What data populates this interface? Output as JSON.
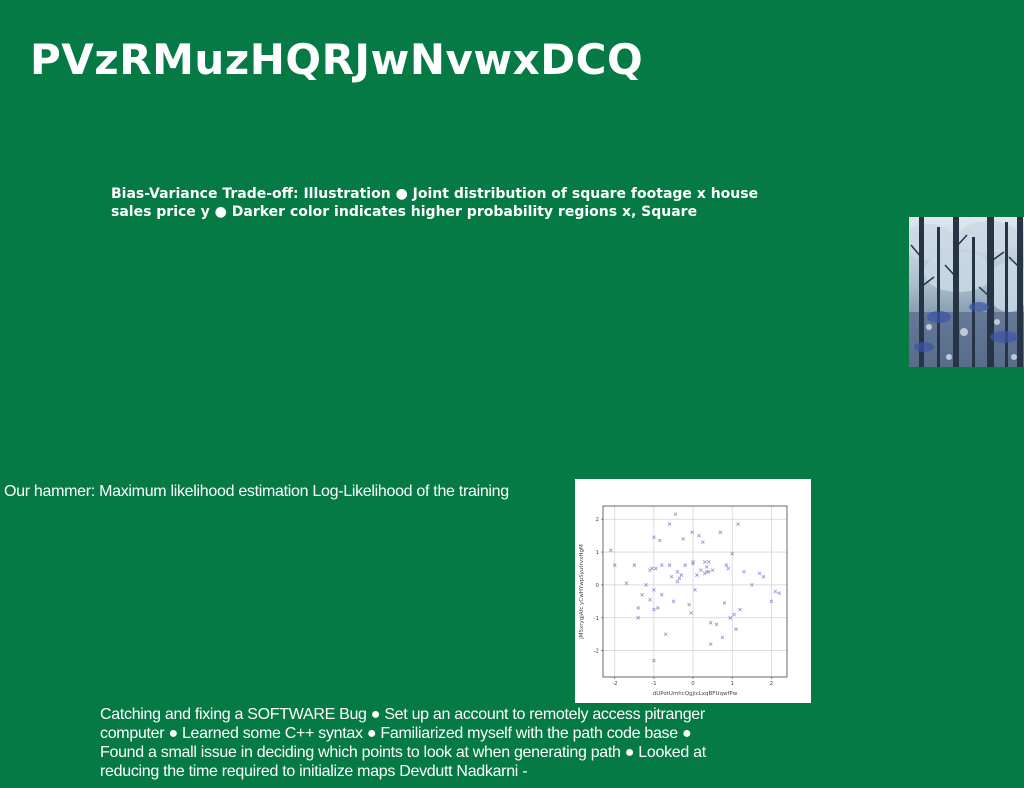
{
  "slide": {
    "title": "PVzRMuzHQRJwNvwxDCQ",
    "subtitle": "Bias-Variance Trade-off: Illustration ● Joint distribution of square footage x house sales price y ● Darker color indicates higher probability regions x, Square",
    "hammer_text": "Our hammer: Maximum likelihood estimation Log-Likelihood of the training",
    "bug_text": "Catching and fixing a SOFTWARE Bug ● Set up an account to remotely access pitranger computer ● Learned some C++ syntax ● Familiarized myself with the path code base ● Found a small issue in deciding which points to look at when generating path ● Looked at reducing the time required to initialize maps Devdutt Nadkarni -",
    "photo_icon": "forest-photo",
    "colors": {
      "background": "#057a44",
      "text": "#ffffff",
      "marker": "#9b8fd6"
    }
  },
  "chart_data": {
    "type": "scatter",
    "title": "",
    "xlabel": "dUPotUmhcQgjicLxqBFUqwfPw",
    "ylabel": "jMSxrygjAfc yCwHYwpSyutrvxHgM",
    "xlim": [
      -2.3,
      2.4
    ],
    "ylim": [
      -2.8,
      2.4
    ],
    "xticks": [
      "-2",
      "-1",
      "0",
      "1",
      "2"
    ],
    "yticks": [
      "2",
      "1",
      "0",
      "-1",
      "-2"
    ],
    "grid": true,
    "marker": "x",
    "x": [
      -2.1,
      -2.0,
      -1.7,
      -1.5,
      -1.4,
      -1.4,
      -1.3,
      -1.2,
      -1.1,
      -1.1,
      -1.05,
      -1.0,
      -1.0,
      -1.0,
      -0.95,
      -0.9,
      -0.85,
      -0.8,
      -0.7,
      -0.6,
      -0.6,
      -0.55,
      -0.5,
      -0.45,
      -0.4,
      -0.4,
      -0.35,
      -0.3,
      -0.25,
      -0.2,
      -0.1,
      -0.05,
      -0.02,
      0.0,
      0.0,
      0.05,
      0.1,
      0.15,
      0.2,
      0.25,
      0.3,
      0.3,
      0.35,
      0.35,
      0.4,
      0.4,
      0.45,
      0.5,
      0.6,
      0.7,
      0.75,
      0.8,
      0.85,
      0.9,
      0.95,
      1.0,
      1.05,
      1.1,
      1.15,
      1.2,
      1.3,
      1.5,
      1.7,
      1.8,
      2.0,
      2.1,
      2.2,
      -0.8,
      0.45,
      -1.0
    ],
    "y": [
      1.05,
      0.6,
      0.05,
      0.6,
      -0.7,
      -1.0,
      -0.3,
      0.0,
      -0.45,
      0.45,
      0.5,
      -0.15,
      -0.75,
      1.45,
      0.5,
      -0.7,
      1.35,
      0.6,
      -1.5,
      1.85,
      0.6,
      0.25,
      -0.5,
      2.15,
      0.1,
      0.4,
      0.2,
      0.3,
      1.4,
      0.6,
      -0.6,
      -0.85,
      1.6,
      0.65,
      0.7,
      -0.15,
      0.3,
      1.5,
      0.45,
      1.3,
      0.35,
      0.7,
      0.4,
      0.55,
      0.4,
      0.7,
      -1.15,
      0.45,
      -1.2,
      1.6,
      -1.6,
      -0.55,
      0.6,
      0.5,
      -1.0,
      0.95,
      -0.9,
      -1.35,
      1.85,
      -0.75,
      0.4,
      0.0,
      0.35,
      0.25,
      -0.5,
      -0.2,
      -0.25,
      -0.3,
      -1.8,
      -2.3
    ]
  }
}
